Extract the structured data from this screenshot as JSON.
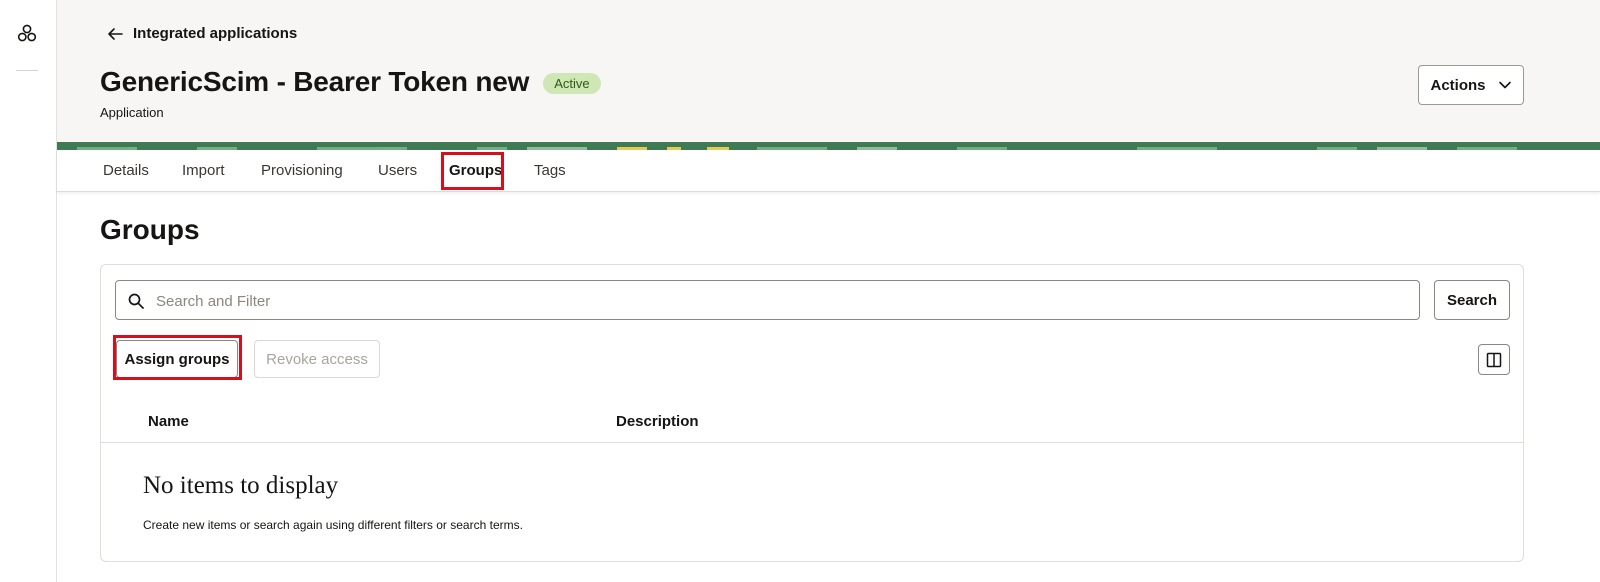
{
  "rail": {
    "app_icon": "app-switcher-icon"
  },
  "header": {
    "back_label": "Integrated applications",
    "title": "GenericScim - Bearer Token new",
    "status": "Active",
    "subtitle": "Application",
    "actions_label": "Actions"
  },
  "tabs": [
    {
      "label": "Details",
      "active": false
    },
    {
      "label": "Import",
      "active": false
    },
    {
      "label": "Provisioning",
      "active": false
    },
    {
      "label": "Users",
      "active": false
    },
    {
      "label": "Groups",
      "active": true
    },
    {
      "label": "Tags",
      "active": false
    }
  ],
  "groups": {
    "title": "Groups",
    "search": {
      "placeholder": "Search and Filter",
      "value": "",
      "button_label": "Search"
    },
    "assign_label": "Assign groups",
    "revoke_label": "Revoke access",
    "columns": [
      "Name",
      "Description"
    ],
    "empty_title": "No items to display",
    "empty_text": "Create new items or search again using different filters or search terms."
  },
  "colors": {
    "accent_highlight": "#d4101e",
    "status_badge_bg": "#cfe6b5",
    "banner_green": "#3f7a52"
  }
}
